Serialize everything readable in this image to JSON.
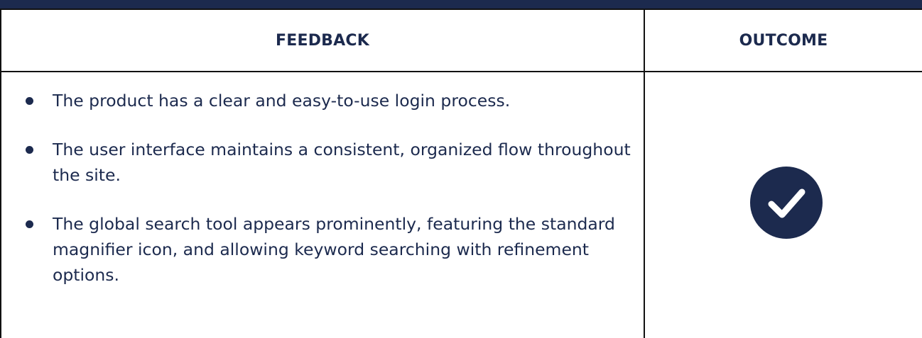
{
  "table": {
    "headers": {
      "feedback": "FEEDBACK",
      "outcome": "OUTCOME"
    },
    "feedback_items": [
      "The product has a clear and easy-to-use login process.",
      "The user interface maintains a consistent, organized flow throughout the site.",
      "The global search tool appears prominently, featuring the standard magnifier icon, and allowing keyword searching with refinement options."
    ],
    "outcome_icon": "checkmark-circle-icon"
  },
  "colors": {
    "navy": "#1c2a4e",
    "border": "#111111",
    "background": "#ffffff"
  }
}
